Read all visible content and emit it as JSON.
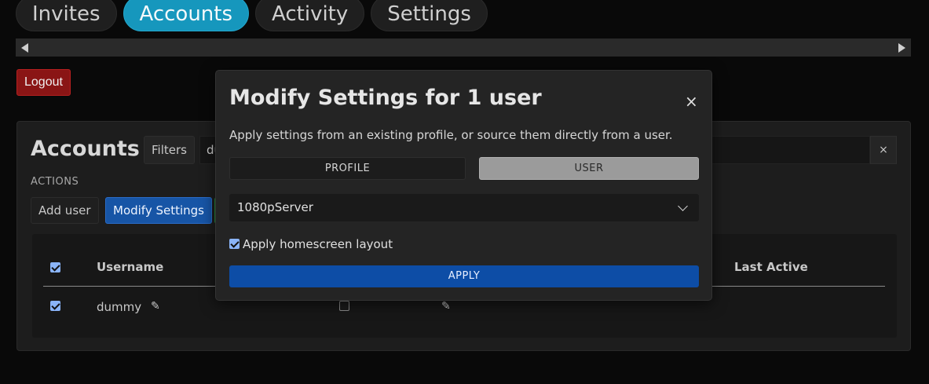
{
  "tabs": [
    {
      "label": "Invites",
      "active": false
    },
    {
      "label": "Accounts",
      "active": true
    },
    {
      "label": "Activity",
      "active": false
    },
    {
      "label": "Settings",
      "active": false
    }
  ],
  "logout_label": "Logout",
  "accounts": {
    "title": "Accounts",
    "filters_label": "Filters",
    "filter_value": "du",
    "clear_label": "×",
    "actions_label": "ACTIONS",
    "add_user_label": "Add user",
    "modify_settings_label": "Modify Settings",
    "table": {
      "headers": {
        "username": "Username",
        "last_active": "Last Active"
      },
      "rows": [
        {
          "username": "dummy",
          "selected": true
        }
      ]
    }
  },
  "modal": {
    "title": "Modify Settings for 1 user",
    "close_label": "×",
    "description": "Apply settings from an existing profile, or source them directly from a user.",
    "segments": {
      "profile": "PROFILE",
      "user": "USER",
      "selected": "user"
    },
    "source_value": "1080pServer",
    "homescreen_label": "Apply homescreen layout",
    "homescreen_checked": true,
    "apply_label": "APPLY"
  },
  "icons": {
    "pencil": "✎"
  },
  "colors": {
    "accent": "#1697bd",
    "primary_button": "#1755a6",
    "apply_button": "#0d4da6",
    "danger": "#8a1515"
  }
}
